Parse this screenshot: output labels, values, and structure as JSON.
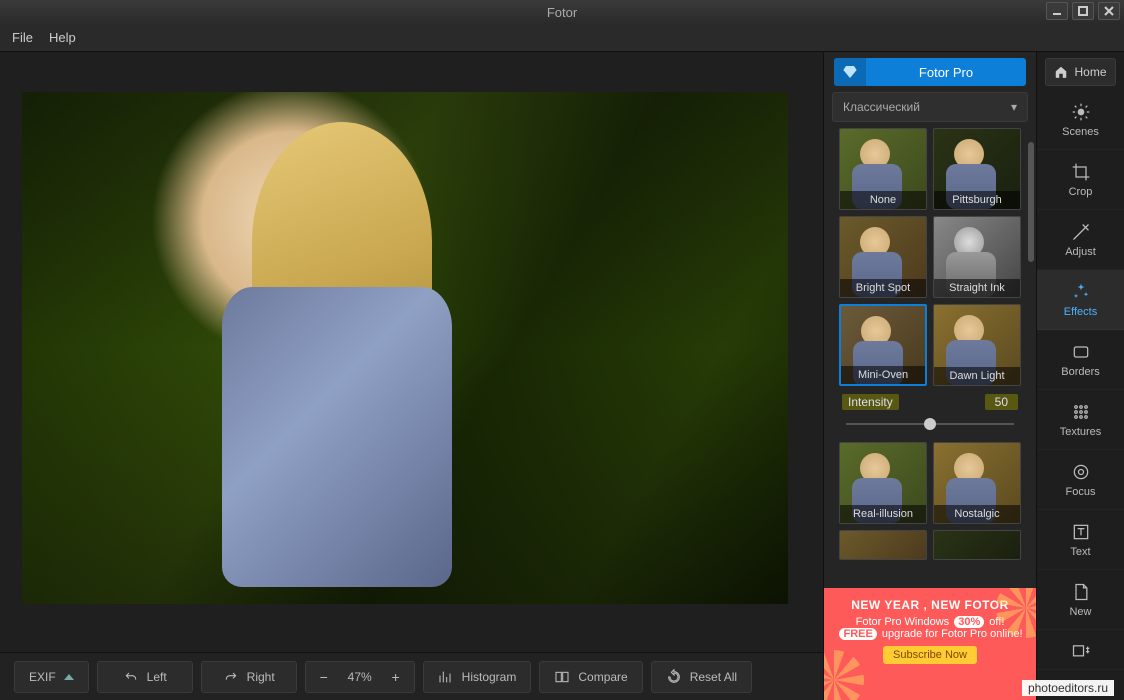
{
  "window": {
    "title": "Fotor"
  },
  "menu": {
    "file": "File",
    "help": "Help"
  },
  "upgrade": {
    "label": "Fotor Pro"
  },
  "home": {
    "label": "Home"
  },
  "category": {
    "label": "Классический"
  },
  "effects": {
    "intensity_label": "Intensity",
    "intensity_value": "50",
    "thumbs": [
      {
        "label": "None"
      },
      {
        "label": "Pittsburgh"
      },
      {
        "label": "Bright Spot"
      },
      {
        "label": "Straight Ink"
      },
      {
        "label": "Mini-Oven"
      },
      {
        "label": "Dawn Light"
      },
      {
        "label": "Real-illusion"
      },
      {
        "label": "Nostalgic"
      }
    ]
  },
  "tools": {
    "scenes": "Scenes",
    "crop": "Crop",
    "adjust": "Adjust",
    "effects": "Effects",
    "borders": "Borders",
    "textures": "Textures",
    "focus": "Focus",
    "text": "Text",
    "new": "New",
    "batch": ""
  },
  "bottom": {
    "exif": "EXIF",
    "left": "Left",
    "right": "Right",
    "zoom": "47%",
    "histogram": "Histogram",
    "compare": "Compare",
    "reset": "Reset All"
  },
  "ad": {
    "headline": "NEW YEAR , NEW FOTOR",
    "line1a": "Fotor Pro Windows ",
    "line1_pill": "30%",
    "line1b": " off!",
    "line2_pill": "FREE",
    "line2": " upgrade for Fotor Pro online!",
    "cta": "Subscribe Now"
  },
  "watermark": "photoeditors.ru"
}
